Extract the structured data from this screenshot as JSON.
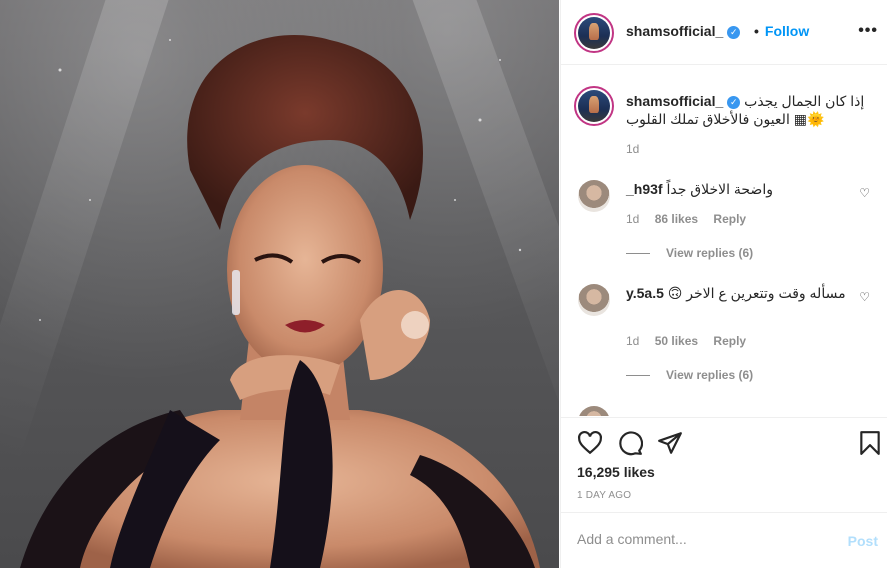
{
  "post": {
    "username": "shamsofficial_",
    "follow_label": "Follow",
    "more_label": "•••",
    "verified_glyph": "✓"
  },
  "caption": {
    "username": "shamsofficial_",
    "text": "إذا كان الجمال يجذب 🌞▦ العيون فالأخلاق تملك القلوب",
    "time": "1d"
  },
  "comments": [
    {
      "username": "_h93f",
      "text": "واضحة الاخلاق جداً",
      "time": "1d",
      "likes": "86 likes",
      "reply_label": "Reply",
      "view_replies": "View replies (6)"
    },
    {
      "username": "y.5a.5",
      "text": "مسأله وقت وتتعرين ع الاخر 🙃",
      "time": "1d",
      "likes": "50 likes",
      "reply_label": "Reply",
      "view_replies": "View replies (6)"
    }
  ],
  "actions": {
    "likes": "16,295 likes",
    "date": "1 DAY AGO"
  },
  "add_comment": {
    "placeholder": "Add a comment...",
    "post_label": "Post"
  },
  "icons": {
    "heart": "heart-icon",
    "comment": "comment-icon",
    "share": "share-icon",
    "save": "bookmark-icon"
  },
  "colors": {
    "link": "#0095f6",
    "verified": "#3897f0",
    "post_disabled": "#b2dffc",
    "muted": "#8e8e8e"
  }
}
